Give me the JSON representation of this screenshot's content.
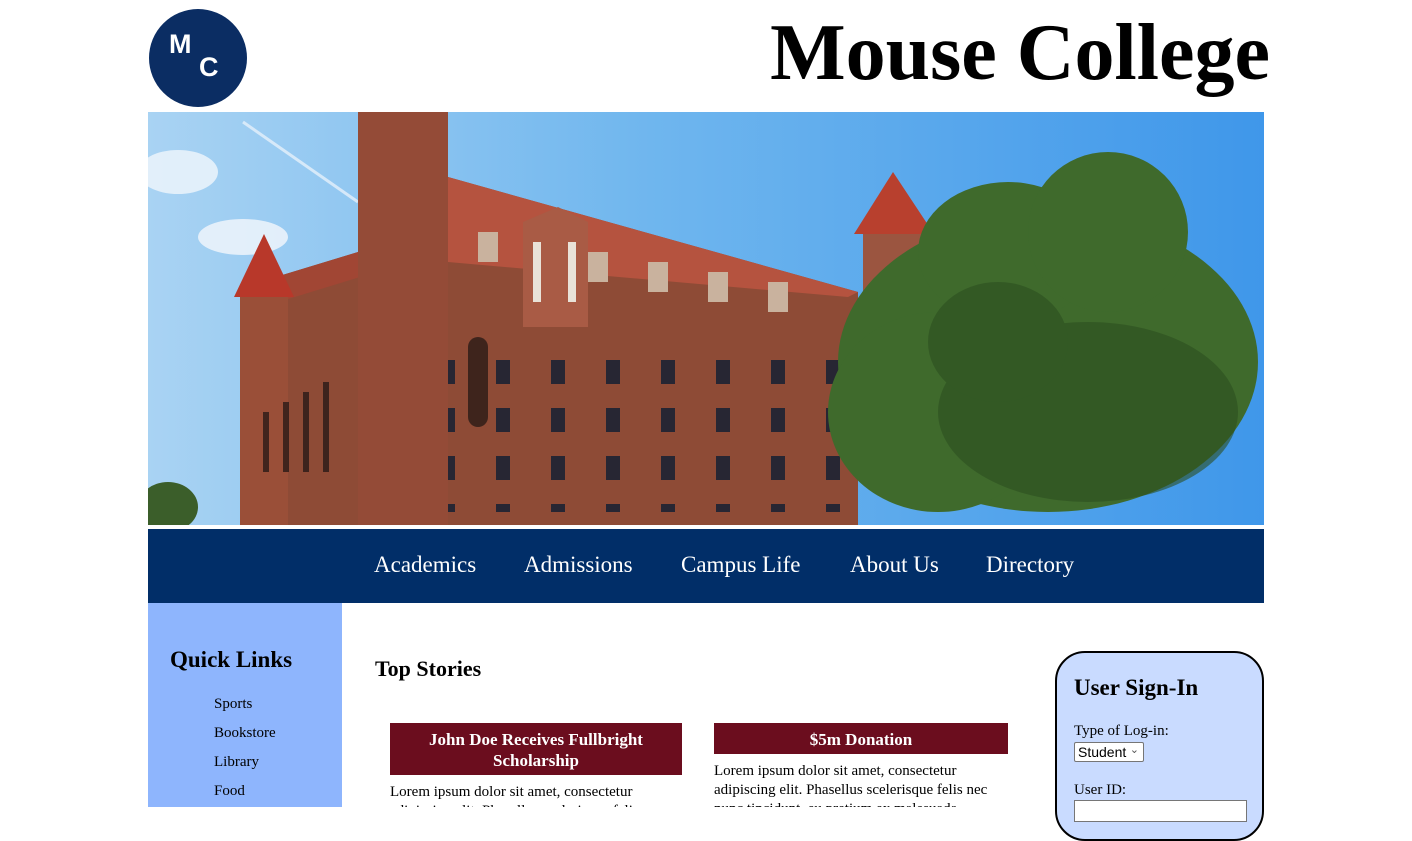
{
  "header": {
    "logo": {
      "letter_top": "M",
      "letter_bottom": "C"
    },
    "title": "Mouse College"
  },
  "hero": {
    "image": "brick-castle-campus-building-photo"
  },
  "nav": {
    "items": [
      "Academics",
      "Admissions",
      "Campus Life",
      "About Us",
      "Directory"
    ]
  },
  "sidebar": {
    "title": "Quick Links",
    "links": [
      "Sports",
      "Bookstore",
      "Library",
      "Food"
    ]
  },
  "main": {
    "section_title": "Top Stories",
    "stories": [
      {
        "headline": "John Doe Receives Fullbright Scholarship",
        "body": "Lorem ipsum dolor sit amet, consectetur adipiscing elit. Phasellus scelerisque felis"
      },
      {
        "headline": "$5m Donation",
        "body": "Lorem ipsum dolor sit amet, consectetur adipiscing elit. Phasellus scelerisque felis nec nunc tincidunt, eu pretium ex malesuada."
      }
    ]
  },
  "signin": {
    "title": "User Sign-In",
    "type_label": "Type of Log-in:",
    "type_selected": "Student",
    "user_id_label": "User ID:",
    "user_id_value": ""
  },
  "colors": {
    "navy": "#012e68",
    "logo_navy": "#0b2d63",
    "sidebar_blue": "#8eb5fd",
    "signin_blue": "#c9dbff",
    "story_maroon": "#6b0d1e"
  }
}
